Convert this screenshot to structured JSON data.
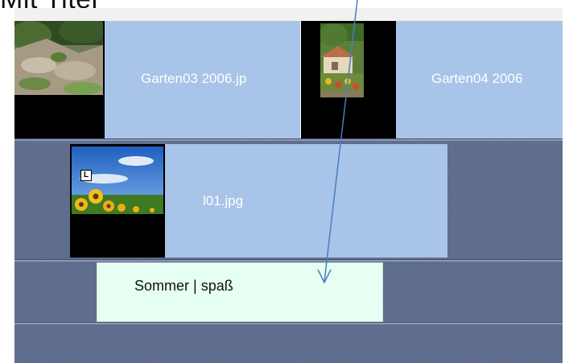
{
  "heading": {
    "text": "Mit Titel"
  },
  "tracks": {
    "video1": {
      "clips": [
        {
          "label": "Garten03 2006.jp"
        },
        {
          "label": "Garten04 2006"
        }
      ]
    },
    "video2": {
      "clips": [
        {
          "label": "l01.jpg",
          "badge": "L"
        }
      ]
    },
    "title": {
      "text": "Sommer | spaß"
    }
  },
  "colors": {
    "track_background": "#5d6b8c",
    "clip_background": "#a8c4e8",
    "title_clip_background": "#e6fff3",
    "arrow": "#4a7ebd"
  }
}
